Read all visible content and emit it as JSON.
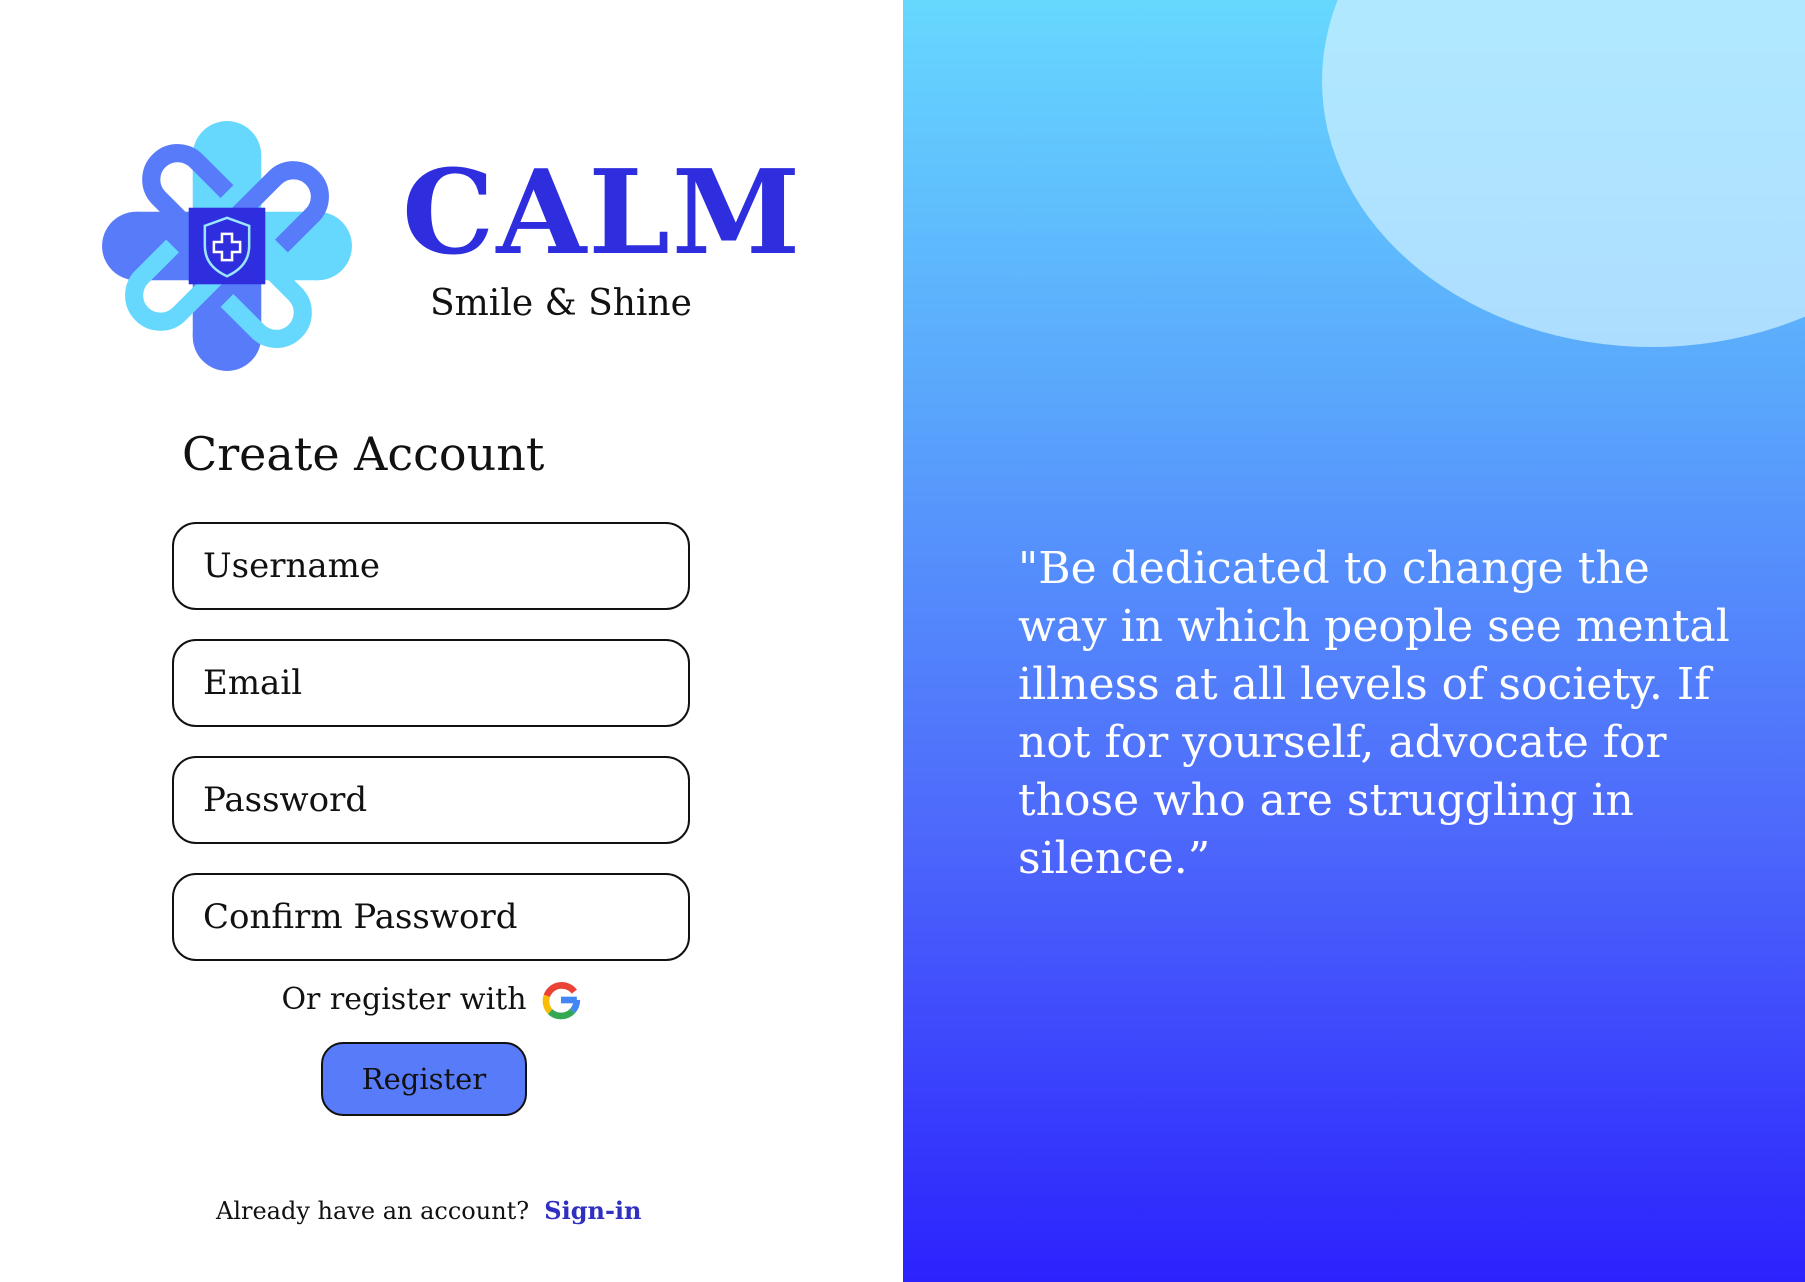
{
  "brand": {
    "name": "CALM",
    "tagline": "Smile & Shine",
    "logo_icon": "heart-knot-shield-logo",
    "colors": {
      "brand_text": "#2e2ede",
      "light_blue": "#66d8fe",
      "mid_blue": "#587bfa",
      "deep_blue": "#2b22fd"
    }
  },
  "form": {
    "title": "Create Account",
    "fields": [
      {
        "placeholder": "Username",
        "value": ""
      },
      {
        "placeholder": "Email",
        "value": ""
      },
      {
        "placeholder": "Password",
        "value": ""
      },
      {
        "placeholder": "Confirm Password",
        "value": ""
      }
    ],
    "alt_register_text": "Or register with",
    "alt_register_icon": "google-icon",
    "register_label": "Register",
    "signin_prompt": "Already have an account?",
    "signin_link": "Sign-in"
  },
  "quote": {
    "text": "\"Be dedicated to change the\nway in which people see mental\nillness at all levels of society. If\nnot for yourself, advocate for\nthose who are struggling in\nsilence.”"
  }
}
